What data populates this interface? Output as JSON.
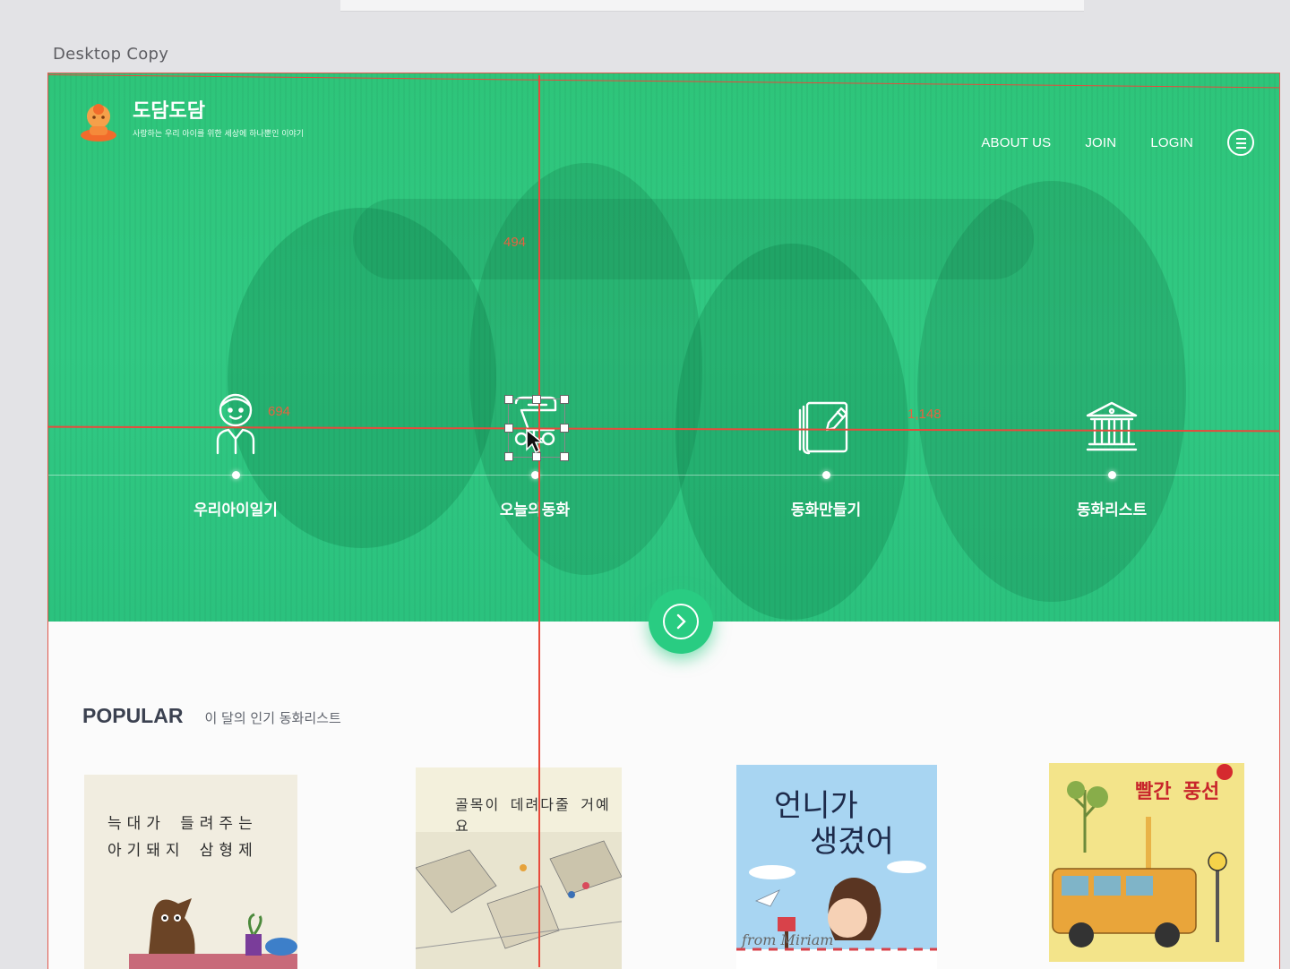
{
  "artboard": {
    "label": "Desktop Copy"
  },
  "header": {
    "logo_title": "도담도담",
    "logo_subtitle": "사랑하는 우리 아이를 위한 세상에 하나뿐인 이야기",
    "nav": [
      "ABOUT US",
      "JOIN",
      "LOGIN"
    ]
  },
  "features": [
    {
      "label": "우리아이일기",
      "icon": "child-face-icon"
    },
    {
      "label": "오늘의동화",
      "icon": "storybook-scroll-icon"
    },
    {
      "label": "동화만들기",
      "icon": "book-edit-icon"
    },
    {
      "label": "동화리스트",
      "icon": "library-building-icon"
    }
  ],
  "popular": {
    "title": "POPULAR",
    "subtitle": "이 달의 인기 동화리스트",
    "books": [
      {
        "title_line1": "늑대가 들려주는",
        "title_line2": "아기돼지 삼형제"
      },
      {
        "title": "골목이 데려다줄 거예요"
      },
      {
        "title_line1": "언니가",
        "title_line2": "생겼어",
        "signature": "from Miriam"
      },
      {
        "title": "빨간 풍선"
      }
    ]
  },
  "measurements": {
    "top": "494",
    "left": "694",
    "right": "1,148"
  },
  "colors": {
    "hero": "#2ec57a",
    "accent": "#29cc82",
    "guide": "#e84a3c"
  }
}
